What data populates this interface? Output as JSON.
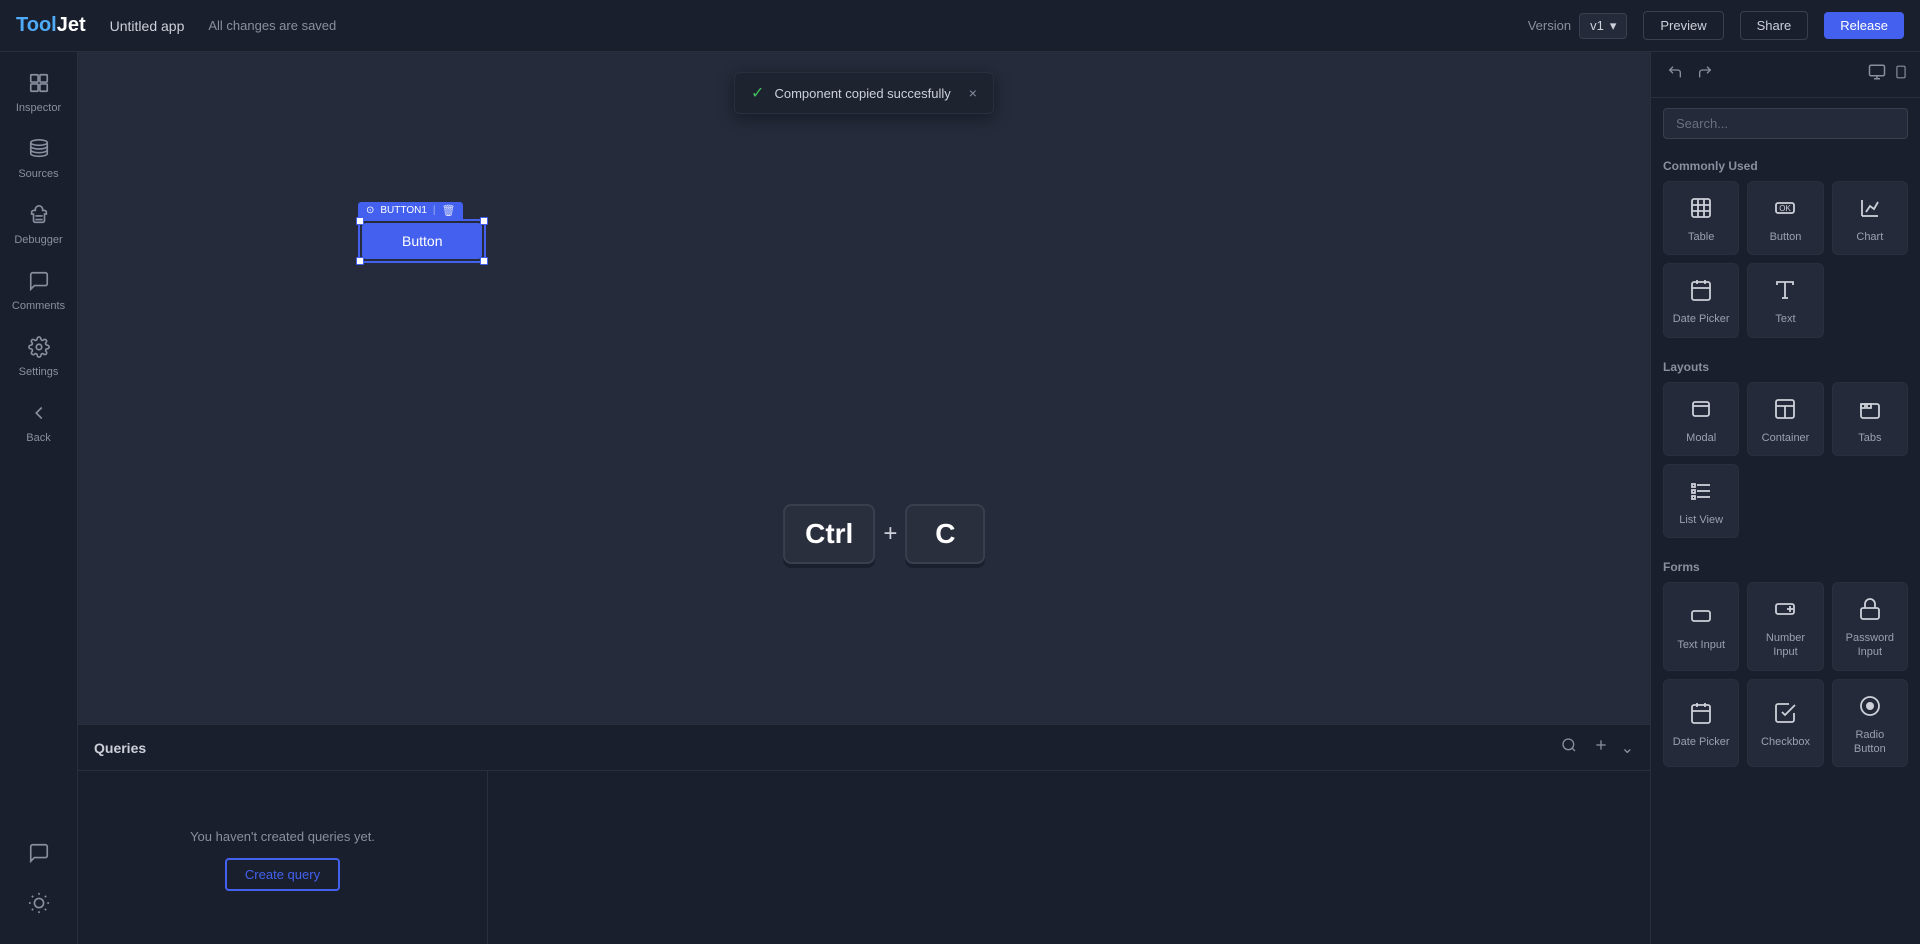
{
  "topbar": {
    "logo": "Tool",
    "logo_accent": "Jet",
    "app_title": "Untitled app",
    "save_status": "All changes are saved",
    "version_label": "Version",
    "version_value": "v1",
    "preview_label": "Preview",
    "share_label": "Share",
    "release_label": "Release"
  },
  "sidebar": {
    "items": [
      {
        "id": "inspector",
        "label": "Inspector",
        "icon": "⬚"
      },
      {
        "id": "sources",
        "label": "Sources",
        "icon": "🗄"
      },
      {
        "id": "debugger",
        "label": "Debugger",
        "icon": "🐛"
      },
      {
        "id": "comments",
        "label": "Comments",
        "icon": "💬"
      },
      {
        "id": "settings",
        "label": "Settings",
        "icon": "⚙"
      },
      {
        "id": "back",
        "label": "Back",
        "icon": "↩"
      }
    ],
    "bottom_items": [
      {
        "id": "chat",
        "icon": "💬"
      },
      {
        "id": "theme",
        "icon": "☀"
      }
    ]
  },
  "canvas": {
    "button_label": "BUTTON1",
    "button_text": "Button"
  },
  "toast": {
    "text": "Component copied succesfully",
    "close": "×"
  },
  "keyboard_shortcut": {
    "key1": "Ctrl",
    "plus": "+",
    "key2": "C"
  },
  "bottom_panel": {
    "title": "Queries",
    "empty_text": "You haven't created queries yet.",
    "create_btn": "Create query",
    "chevron": "⌄"
  },
  "right_panel": {
    "search_placeholder": "Search...",
    "sections": [
      {
        "title": "Commonly Used",
        "components": [
          {
            "label": "Table",
            "icon": "⊞"
          },
          {
            "label": "Button",
            "icon": "OK"
          },
          {
            "label": "Chart",
            "icon": "📊"
          },
          {
            "label": "Date Picker",
            "icon": "📅"
          },
          {
            "label": "Text",
            "icon": "T"
          }
        ]
      },
      {
        "title": "Layouts",
        "components": [
          {
            "label": "Modal",
            "icon": "⬜"
          },
          {
            "label": "Container",
            "icon": "⊞"
          },
          {
            "label": "Tabs",
            "icon": "⊟"
          },
          {
            "label": "List View",
            "icon": "☰"
          }
        ]
      },
      {
        "title": "Forms",
        "components": [
          {
            "label": "Text Input",
            "icon": "☐"
          },
          {
            "label": "Number Input",
            "icon": "+"
          },
          {
            "label": "Password Input",
            "icon": "🔒"
          },
          {
            "label": "Date Picker",
            "icon": "📅"
          },
          {
            "label": "Checkbox",
            "icon": "☑"
          },
          {
            "label": "Radio Button",
            "icon": "⊙"
          }
        ]
      }
    ]
  }
}
